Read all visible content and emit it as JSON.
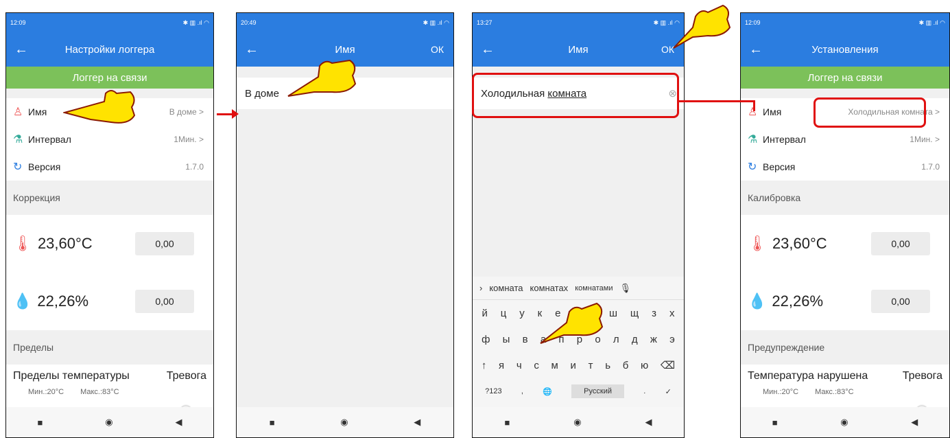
{
  "screens": [
    {
      "time": "12:09",
      "title": "Настройки логгера",
      "status": "Логгер на связи",
      "rows": [
        {
          "label": "Имя",
          "value": "В доме",
          "chev": ">"
        },
        {
          "label": "Интервал",
          "value": "1Мин.",
          "chev": ">"
        },
        {
          "label": "Версия",
          "value": "1.7.0",
          "chev": ""
        }
      ],
      "section1": "Коррекция",
      "temp": "23,60°C",
      "temp_corr": "0,00",
      "hum": "22,26%",
      "hum_corr": "0,00",
      "section2": "Пределы",
      "limit_title": "Пределы температуры",
      "alarm": "Тревога",
      "min": "Мин.:20°C",
      "max": "Макс.:83°C"
    },
    {
      "time": "20:49",
      "title": "Имя",
      "ok": "ОК",
      "value": "В доме"
    },
    {
      "time": "13:27",
      "title": "Имя",
      "ok": "ОК",
      "value_prefix": "Холодильная ",
      "value_word": "комната",
      "suggestions": [
        "комната",
        "комнатах",
        "комнатами"
      ],
      "row1": [
        "й",
        "ц",
        "у",
        "к",
        "е",
        "н",
        "г",
        "ш",
        "щ",
        "з",
        "х"
      ],
      "row2": [
        "ф",
        "ы",
        "в",
        "а",
        "п",
        "р",
        "о",
        "л",
        "д",
        "ж",
        "э"
      ],
      "row3": [
        "↑",
        "я",
        "ч",
        "с",
        "м",
        "и",
        "т",
        "ь",
        "б",
        "ю",
        "⌫"
      ],
      "row4": [
        "?123",
        ",",
        "🌐",
        "Русский",
        ".",
        "✓"
      ]
    },
    {
      "time": "12:09",
      "title": "Установления",
      "status": "Логгер на связи",
      "rows": [
        {
          "label": "Имя",
          "value": "Холодильная комната",
          "chev": ">"
        },
        {
          "label": "Интервал",
          "value": "1Мин.",
          "chev": ">"
        },
        {
          "label": "Версия",
          "value": "1.7.0",
          "chev": ""
        }
      ],
      "section1": "Калибровка",
      "temp": "23,60°C",
      "temp_corr": "0,00",
      "hum": "22,26%",
      "hum_corr": "0,00",
      "section2": "Предупреждение",
      "limit_title": "Температура нарушена",
      "alarm": "Тревога",
      "min": "Мин.:20°C",
      "max": "Макс.:83°C"
    }
  ],
  "nav": {
    "square": "■",
    "circle": "◉",
    "back": "◀"
  },
  "colors": {
    "accent": "#2b7de0",
    "green": "#7cc15a",
    "annotation": "#e01010"
  }
}
